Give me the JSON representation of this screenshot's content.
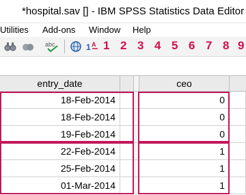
{
  "window": {
    "title": "*hospital.sav [] - IBM SPSS Statistics Data Editor"
  },
  "menu": [
    "Utilities",
    "Add-ons",
    "Window",
    "Help"
  ],
  "toolbar": {
    "icons": [
      "binoculars-icon",
      "spellcheck-icon",
      "globe-icon",
      "value-labels-icon"
    ],
    "numbers": [
      "1",
      "2",
      "3",
      "4",
      "5",
      "6",
      "7",
      "8",
      "9"
    ]
  },
  "grid": {
    "columns": [
      "entry_date",
      "ceo"
    ],
    "rows": [
      {
        "entry_date": "18-Feb-2014",
        "ceo": "0"
      },
      {
        "entry_date": "18-Feb-2014",
        "ceo": "0"
      },
      {
        "entry_date": "19-Feb-2014",
        "ceo": "0"
      },
      {
        "entry_date": "22-Feb-2014",
        "ceo": "1"
      },
      {
        "entry_date": "25-Feb-2014",
        "ceo": "1"
      },
      {
        "entry_date": "01-Mar-2014",
        "ceo": "1"
      }
    ]
  },
  "colors": {
    "highlight": "#c2185b",
    "toolbar_numbers": "#d0104c",
    "header_bg": "#eaeaea"
  }
}
